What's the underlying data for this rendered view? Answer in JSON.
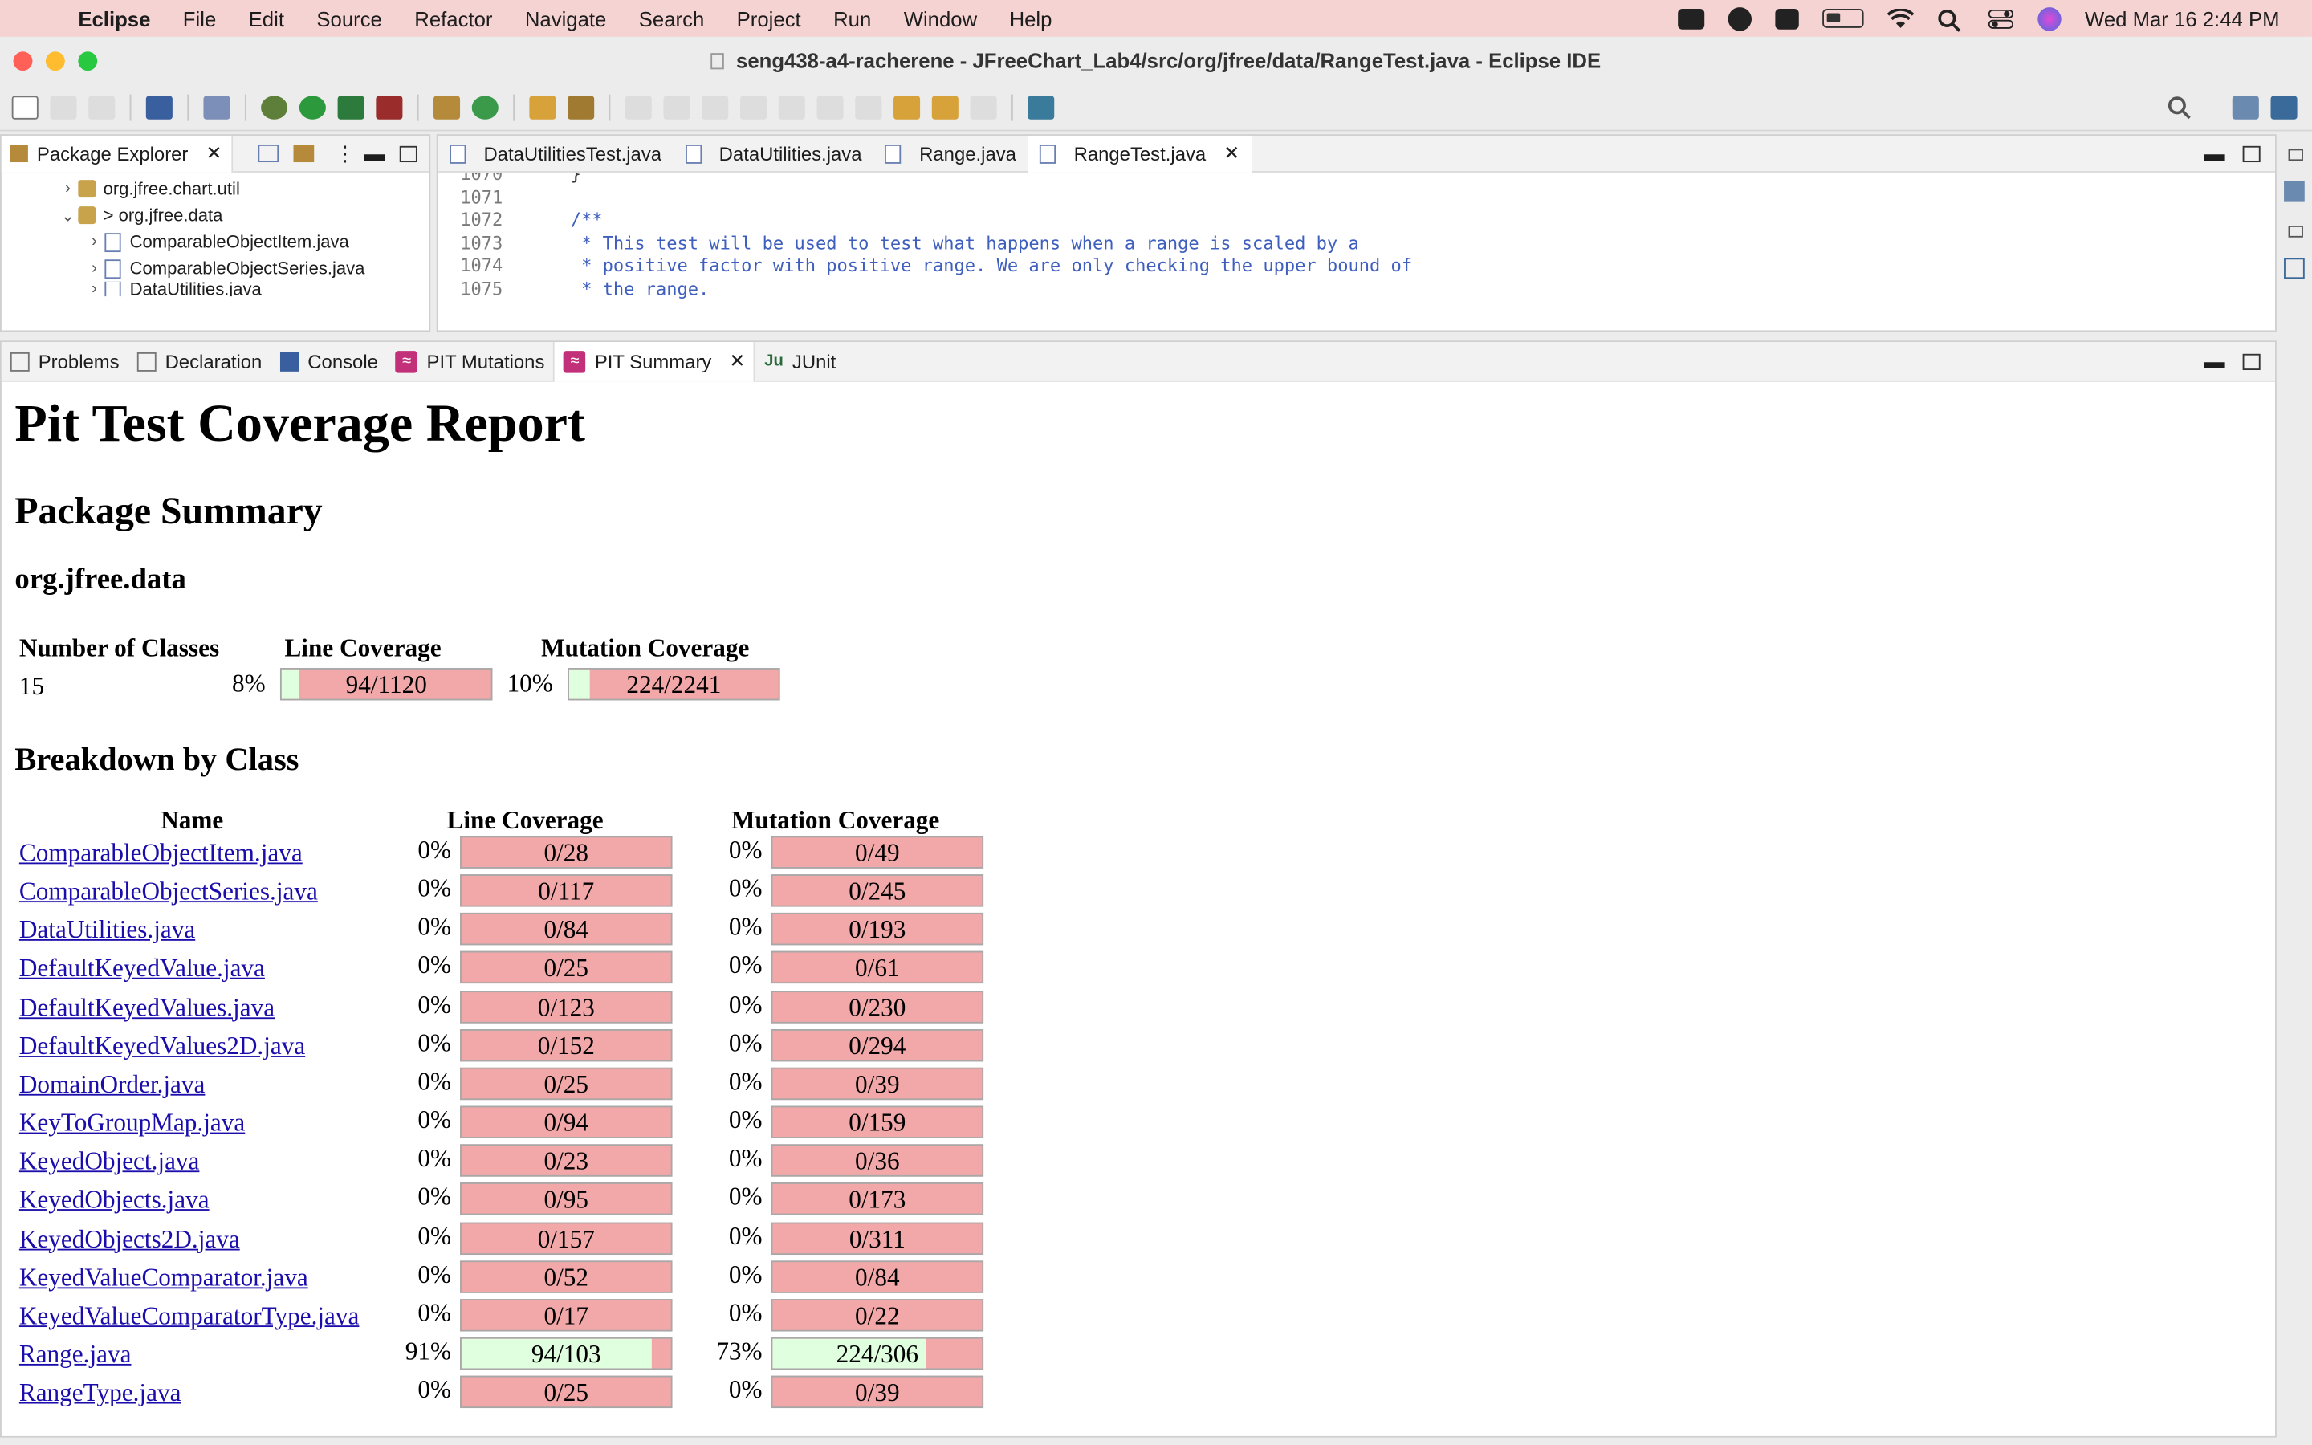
{
  "menubar": {
    "app_name": "Eclipse",
    "items": [
      "File",
      "Edit",
      "Source",
      "Refactor",
      "Navigate",
      "Search",
      "Project",
      "Run",
      "Window",
      "Help"
    ],
    "clock": "Wed Mar 16  2:44 PM"
  },
  "window": {
    "title": "seng438-a4-racherene - JFreeChart_Lab4/src/org/jfree/data/RangeTest.java - Eclipse IDE"
  },
  "package_explorer": {
    "tab_label": "Package Explorer",
    "tree": [
      {
        "twisty": ">",
        "label": "org.jfree.chart.util"
      },
      {
        "twisty": "v",
        "label": "> org.jfree.data"
      },
      {
        "twisty": ">",
        "label": "ComparableObjectItem.java"
      },
      {
        "twisty": ">",
        "label": "ComparableObjectSeries.java"
      },
      {
        "twisty": ">",
        "label": "DataUtilities.java"
      }
    ]
  },
  "editor": {
    "tabs": [
      "DataUtilitiesTest.java",
      "DataUtilities.java",
      "Range.java",
      "RangeTest.java"
    ],
    "active_tab": "RangeTest.java",
    "lines": [
      {
        "num": "1070",
        "text": "}"
      },
      {
        "num": "1071",
        "text": ""
      },
      {
        "num": "1072",
        "text": "/**"
      },
      {
        "num": "1073",
        "text": " * This test will be used to test what happens when a range is scaled by a"
      },
      {
        "num": "1074",
        "text": " * positive factor with positive range. We are only checking the upper bound of"
      },
      {
        "num": "1075",
        "text": " * the range."
      }
    ]
  },
  "bottom_tabs": {
    "tabs": [
      "Problems",
      "Declaration",
      "Console",
      "PIT Mutations",
      "PIT Summary",
      "JUnit"
    ],
    "active": "PIT Summary"
  },
  "report": {
    "title": "Pit Test Coverage Report",
    "package_summary_heading": "Package Summary",
    "package_name": "org.jfree.data",
    "summary_headers": {
      "classes": "Number of Classes",
      "line": "Line Coverage",
      "mutation": "Mutation Coverage"
    },
    "summary": {
      "classes": "15",
      "line_pct": "8%",
      "line_label": "94/1120",
      "line_fraction": 0.084,
      "mut_pct": "10%",
      "mut_label": "224/2241",
      "mut_fraction": 0.1
    },
    "breakdown_heading": "Breakdown by Class",
    "breakdown_headers": {
      "name": "Name",
      "line": "Line Coverage",
      "mutation": "Mutation Coverage"
    },
    "classes": [
      {
        "name": "ComparableObjectItem.java",
        "line_pct": "0%",
        "line": "0/28",
        "line_fraction": 0,
        "mut_pct": "0%",
        "mut": "0/49",
        "mut_fraction": 0
      },
      {
        "name": "ComparableObjectSeries.java",
        "line_pct": "0%",
        "line": "0/117",
        "line_fraction": 0,
        "mut_pct": "0%",
        "mut": "0/245",
        "mut_fraction": 0
      },
      {
        "name": "DataUtilities.java",
        "line_pct": "0%",
        "line": "0/84",
        "line_fraction": 0,
        "mut_pct": "0%",
        "mut": "0/193",
        "mut_fraction": 0
      },
      {
        "name": "DefaultKeyedValue.java",
        "line_pct": "0%",
        "line": "0/25",
        "line_fraction": 0,
        "mut_pct": "0%",
        "mut": "0/61",
        "mut_fraction": 0
      },
      {
        "name": "DefaultKeyedValues.java",
        "line_pct": "0%",
        "line": "0/123",
        "line_fraction": 0,
        "mut_pct": "0%",
        "mut": "0/230",
        "mut_fraction": 0
      },
      {
        "name": "DefaultKeyedValues2D.java",
        "line_pct": "0%",
        "line": "0/152",
        "line_fraction": 0,
        "mut_pct": "0%",
        "mut": "0/294",
        "mut_fraction": 0
      },
      {
        "name": "DomainOrder.java",
        "line_pct": "0%",
        "line": "0/25",
        "line_fraction": 0,
        "mut_pct": "0%",
        "mut": "0/39",
        "mut_fraction": 0
      },
      {
        "name": "KeyToGroupMap.java",
        "line_pct": "0%",
        "line": "0/94",
        "line_fraction": 0,
        "mut_pct": "0%",
        "mut": "0/159",
        "mut_fraction": 0
      },
      {
        "name": "KeyedObject.java",
        "line_pct": "0%",
        "line": "0/23",
        "line_fraction": 0,
        "mut_pct": "0%",
        "mut": "0/36",
        "mut_fraction": 0
      },
      {
        "name": "KeyedObjects.java",
        "line_pct": "0%",
        "line": "0/95",
        "line_fraction": 0,
        "mut_pct": "0%",
        "mut": "0/173",
        "mut_fraction": 0
      },
      {
        "name": "KeyedObjects2D.java",
        "line_pct": "0%",
        "line": "0/157",
        "line_fraction": 0,
        "mut_pct": "0%",
        "mut": "0/311",
        "mut_fraction": 0
      },
      {
        "name": "KeyedValueComparator.java",
        "line_pct": "0%",
        "line": "0/52",
        "line_fraction": 0,
        "mut_pct": "0%",
        "mut": "0/84",
        "mut_fraction": 0
      },
      {
        "name": "KeyedValueComparatorType.java",
        "line_pct": "0%",
        "line": "0/17",
        "line_fraction": 0,
        "mut_pct": "0%",
        "mut": "0/22",
        "mut_fraction": 0
      },
      {
        "name": "Range.java",
        "line_pct": "91%",
        "line": "94/103",
        "line_fraction": 0.91,
        "mut_pct": "73%",
        "mut": "224/306",
        "mut_fraction": 0.73
      },
      {
        "name": "RangeType.java",
        "line_pct": "0%",
        "line": "0/25",
        "line_fraction": 0,
        "mut_pct": "0%",
        "mut": "0/39",
        "mut_fraction": 0
      }
    ]
  },
  "colors": {
    "covered": "#dfffdf",
    "uncovered": "#f2a8a8",
    "link": "#1a0dab"
  }
}
